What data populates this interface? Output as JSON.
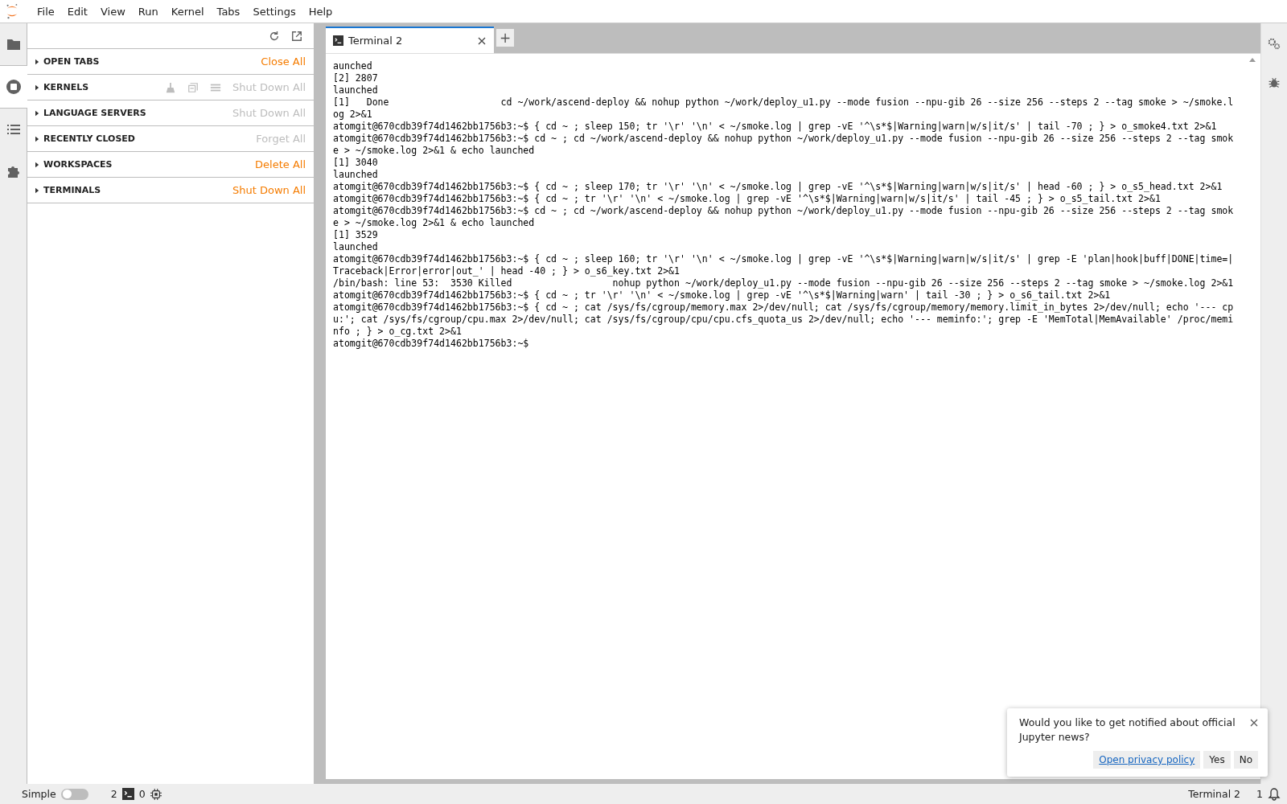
{
  "menu": [
    "File",
    "Edit",
    "View",
    "Run",
    "Kernel",
    "Tabs",
    "Settings",
    "Help"
  ],
  "activity_bar": [
    {
      "kind": "folder",
      "selected": false
    },
    {
      "kind": "running",
      "selected": true
    },
    {
      "kind": "toc",
      "selected": false
    },
    {
      "kind": "extension",
      "selected": false
    }
  ],
  "sidebar": {
    "sections": [
      {
        "title": "OPEN TABS",
        "action": "Close All",
        "disabled": false,
        "kind": "plain"
      },
      {
        "title": "KERNELS",
        "action": "Shut Down All",
        "disabled": true,
        "kind": "with-tools"
      },
      {
        "title": "LANGUAGE SERVERS",
        "action": "Shut Down All",
        "disabled": true,
        "kind": "plain"
      },
      {
        "title": "RECENTLY CLOSED",
        "action": "Forget All",
        "disabled": true,
        "kind": "plain"
      },
      {
        "title": "WORKSPACES",
        "action": "Delete All",
        "disabled": false,
        "kind": "plain"
      },
      {
        "title": "TERMINALS",
        "action": "Shut Down All",
        "disabled": false,
        "kind": "plain"
      }
    ]
  },
  "tabs": [
    {
      "label": "Terminal 2",
      "selected": true
    }
  ],
  "new_tab_button": "+",
  "terminal": {
    "lines": [
      "aunched",
      "[2] 2807",
      "launched",
      "[1]   Done                    cd ~/work/ascend-deploy && nohup python ~/work/deploy_u1.py --mode fusion --npu-gib 26 --size 256 --steps 2 --tag smoke > ~/smoke.l",
      "og 2>&1",
      "atomgit@670cdb39f74d1462bb1756b3:~$ { cd ~ ; sleep 150; tr '\\r' '\\n' < ~/smoke.log | grep -vE '^\\s*$|Warning|warn|w/s|it/s' | tail -70 ; } > o_smoke4.txt 2>&1",
      "atomgit@670cdb39f74d1462bb1756b3:~$ cd ~ ; cd ~/work/ascend-deploy && nohup python ~/work/deploy_u1.py --mode fusion --npu-gib 26 --size 256 --steps 2 --tag smok",
      "e > ~/smoke.log 2>&1 & echo launched",
      "[1] 3040",
      "launched",
      "atomgit@670cdb39f74d1462bb1756b3:~$ { cd ~ ; sleep 170; tr '\\r' '\\n' < ~/smoke.log | grep -vE '^\\s*$|Warning|warn|w/s|it/s' | head -60 ; } > o_s5_head.txt 2>&1",
      "atomgit@670cdb39f74d1462bb1756b3:~$ { cd ~ ; tr '\\r' '\\n' < ~/smoke.log | grep -vE '^\\s*$|Warning|warn|w/s|it/s' | tail -45 ; } > o_s5_tail.txt 2>&1",
      "atomgit@670cdb39f74d1462bb1756b3:~$ cd ~ ; cd ~/work/ascend-deploy && nohup python ~/work/deploy_u1.py --mode fusion --npu-gib 26 --size 256 --steps 2 --tag smok",
      "e > ~/smoke.log 2>&1 & echo launched",
      "[1] 3529",
      "launched",
      "atomgit@670cdb39f74d1462bb1756b3:~$ { cd ~ ; sleep 160; tr '\\r' '\\n' < ~/smoke.log | grep -vE '^\\s*$|Warning|warn|w/s|it/s' | grep -E 'plan|hook|buff|DONE|time=|",
      "Traceback|Error|error|out_' | head -40 ; } > o_s6_key.txt 2>&1",
      "/bin/bash: line 53:  3530 Killed                  nohup python ~/work/deploy_u1.py --mode fusion --npu-gib 26 --size 256 --steps 2 --tag smoke > ~/smoke.log 2>&1",
      "atomgit@670cdb39f74d1462bb1756b3:~$ { cd ~ ; tr '\\r' '\\n' < ~/smoke.log | grep -vE '^\\s*$|Warning|warn' | tail -30 ; } > o_s6_tail.txt 2>&1",
      "atomgit@670cdb39f74d1462bb1756b3:~$ { cd ~ ; cat /sys/fs/cgroup/memory.max 2>/dev/null; cat /sys/fs/cgroup/memory/memory.limit_in_bytes 2>/dev/null; echo '--- cp",
      "u:'; cat /sys/fs/cgroup/cpu.max 2>/dev/null; cat /sys/fs/cgroup/cpu/cpu.cfs_quota_us 2>/dev/null; echo '--- meminfo:'; grep -E 'MemTotal|MemAvailable' /proc/memi",
      "nfo ; } > o_cg.txt 2>&1",
      "atomgit@670cdb39f74d1462bb1756b3:~$"
    ]
  },
  "notification": {
    "message": "Would you like to get notified about official Jupyter news?",
    "link": "Open privacy policy",
    "buttons": [
      "Yes",
      "No"
    ]
  },
  "status_bar": {
    "simple_mode": {
      "label": "Simple",
      "on": false
    },
    "terminals": "2",
    "kernels": "0",
    "current": "Terminal 2",
    "notifications": "1"
  }
}
